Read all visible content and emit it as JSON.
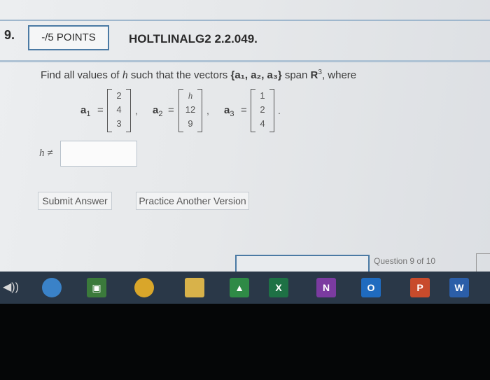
{
  "question": {
    "number": "9.",
    "points": "-/5 POINTS",
    "code": "HOLTLINALG2 2.2.049."
  },
  "prompt": {
    "text_before": "Find all values of ",
    "var_h": "h",
    "text_mid": " such that the vectors ",
    "set": "{a₁, a₂, a₃}",
    "span_word": " span ",
    "space": "R",
    "exponent": "3",
    "text_end": ",  where"
  },
  "vectors": [
    {
      "name": "a",
      "sub": "1",
      "entries": [
        "2",
        "4",
        "3"
      ]
    },
    {
      "name": "a",
      "sub": "2",
      "entries": [
        "h",
        "12",
        "9"
      ]
    },
    {
      "name": "a",
      "sub": "3",
      "entries": [
        "1",
        "2",
        "4"
      ]
    }
  ],
  "symbols": {
    "equals": "=",
    "comma": ",",
    "period": "."
  },
  "answer": {
    "label": "h ≠",
    "value": ""
  },
  "buttons": {
    "submit": "Submit Answer",
    "practice": "Practice Another Version"
  },
  "footer": {
    "question_count": "Question 9 of 10"
  },
  "taskbar": {
    "icons": [
      {
        "name": "edge-icon",
        "letter": "",
        "color": "#3a82c8"
      },
      {
        "name": "store-icon",
        "letter": "▣",
        "color": "#3b7a3b"
      },
      {
        "name": "chrome-icon",
        "letter": "",
        "color": "#d9a62a"
      },
      {
        "name": "file-explorer-icon",
        "letter": "",
        "color": "#d8b24a"
      },
      {
        "name": "google-drive-icon",
        "letter": "▲",
        "color": "#2f8a46"
      },
      {
        "name": "excel-icon",
        "letter": "X",
        "color": "#1e7145"
      },
      {
        "name": "onenote-icon",
        "letter": "N",
        "color": "#7b3ba0"
      },
      {
        "name": "outlook-icon",
        "letter": "O",
        "color": "#1f6bbf"
      },
      {
        "name": "powerpoint-icon",
        "letter": "P",
        "color": "#c84b2c"
      },
      {
        "name": "word-icon",
        "letter": "W",
        "color": "#2b5ea8"
      }
    ]
  }
}
